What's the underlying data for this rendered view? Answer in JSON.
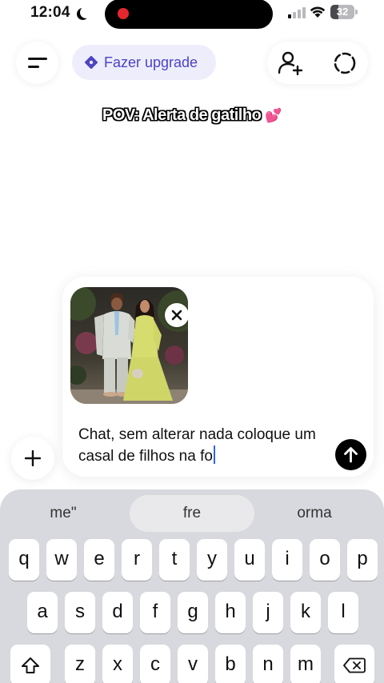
{
  "status_bar": {
    "time": "12:04",
    "battery_level": "32",
    "battery_fraction": 0.32,
    "icons": [
      "moon-icon",
      "record-indicator",
      "signal-icon",
      "wifi-icon",
      "battery-icon"
    ]
  },
  "header": {
    "upgrade_label": "Fazer upgrade",
    "icons": [
      "menu-icon",
      "sparkle-icon",
      "add-person-icon",
      "temporary-chat-icon"
    ]
  },
  "caption": {
    "text": "POV: Alerta de gatilho",
    "emoji": "💕"
  },
  "composer": {
    "attachment_icon": "close-icon",
    "prompt": "Chat, sem alterar nada coloque um casal de filhos na fo",
    "send_icon": "arrow-up-icon",
    "plus_icon": "plus-icon"
  },
  "keyboard": {
    "suggestions": [
      "me\"",
      "fre",
      "orma"
    ],
    "row1": [
      "q",
      "w",
      "e",
      "r",
      "t",
      "y",
      "u",
      "i",
      "o",
      "p"
    ],
    "row2": [
      "a",
      "s",
      "d",
      "f",
      "g",
      "h",
      "j",
      "k",
      "l"
    ],
    "row3": [
      "z",
      "x",
      "c",
      "v",
      "b",
      "n",
      "m"
    ],
    "icons": [
      "shift-icon",
      "delete-icon"
    ]
  },
  "colors": {
    "accent": "#4d43c4",
    "upgrade_bg": "#eeedfc",
    "caret": "#2a67e8",
    "record": "#e6262e",
    "keyboard_bg": "#d8d9de"
  }
}
